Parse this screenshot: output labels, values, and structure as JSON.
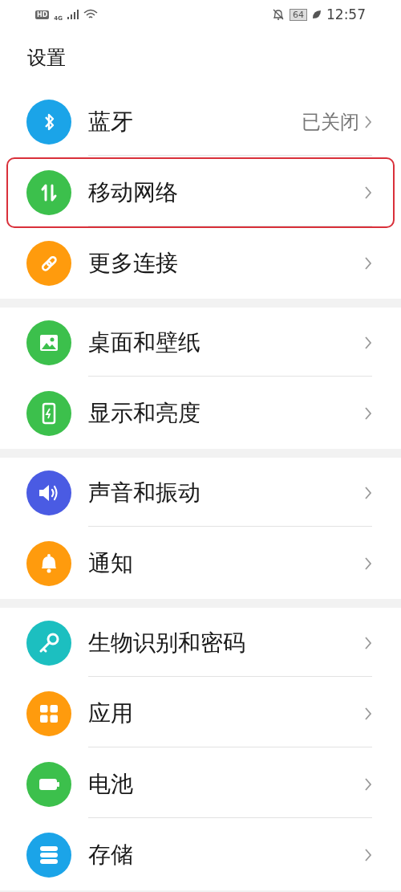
{
  "status_bar": {
    "hd": "HD",
    "network": "4G",
    "battery": "64",
    "time": "12:57"
  },
  "title": "设置",
  "groups": [
    {
      "items": [
        {
          "label": "蓝牙",
          "value": "已关闭",
          "color": "#1ba4e8",
          "highlighted": false
        },
        {
          "label": "移动网络",
          "color": "#3cc04c",
          "highlighted": true
        },
        {
          "label": "更多连接",
          "color": "#ff9b0d",
          "highlighted": false
        }
      ]
    },
    {
      "items": [
        {
          "label": "桌面和壁纸",
          "color": "#3cc04c",
          "highlighted": false
        },
        {
          "label": "显示和亮度",
          "color": "#3cc04c",
          "highlighted": false
        }
      ]
    },
    {
      "items": [
        {
          "label": "声音和振动",
          "color": "#4a5be3",
          "highlighted": false
        },
        {
          "label": "通知",
          "color": "#ff9b0d",
          "highlighted": false
        }
      ]
    },
    {
      "items": [
        {
          "label": "生物识别和密码",
          "color": "#1cbfc0",
          "highlighted": false
        },
        {
          "label": "应用",
          "color": "#ff9b0d",
          "highlighted": false
        },
        {
          "label": "电池",
          "color": "#3cc04c",
          "highlighted": false
        },
        {
          "label": "存储",
          "color": "#1ba4e8",
          "highlighted": false
        }
      ]
    }
  ]
}
